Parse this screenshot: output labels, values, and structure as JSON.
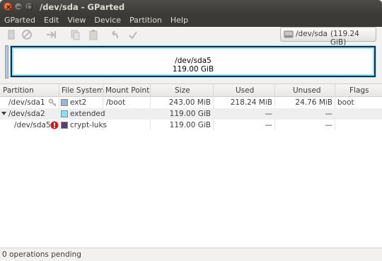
{
  "window": {
    "title": "/dev/sda - GParted"
  },
  "menu": [
    "GParted",
    "Edit",
    "View",
    "Device",
    "Partition",
    "Help"
  ],
  "toolbar": {
    "icons": [
      "new-icon",
      "delete-icon",
      "resize-icon",
      "copy-icon",
      "paste-icon",
      "undo-icon",
      "apply-icon"
    ]
  },
  "device_selector": {
    "device": "/dev/sda",
    "size": "(119.24 GiB)"
  },
  "disk_map": {
    "partition": "/dev/sda5",
    "size": "119.00 GiB"
  },
  "table": {
    "headers": [
      "Partition",
      "File System",
      "Mount Point",
      "Size",
      "Used",
      "Unused",
      "Flags"
    ],
    "rows": [
      {
        "partition": "/dev/sda1",
        "fs": "ext2",
        "fs_color": "#9cb4d8",
        "mount": "/boot",
        "size": "243.00 MiB",
        "used": "218.24 MiB",
        "unused": "24.76 MiB",
        "flags": "boot"
      },
      {
        "partition": "/dev/sda2",
        "fs": "extended",
        "fs_color": "#7ee5f3",
        "mount": "",
        "size": "119.00 GiB",
        "used": "—",
        "unused": "—",
        "flags": ""
      },
      {
        "partition": "/dev/sda5",
        "fs": "crypt-luks",
        "fs_color": "#5c3f72",
        "mount": "",
        "size": "119.00 GiB",
        "used": "—",
        "unused": "—",
        "flags": ""
      }
    ]
  },
  "status": {
    "text": "0 operations pending"
  }
}
